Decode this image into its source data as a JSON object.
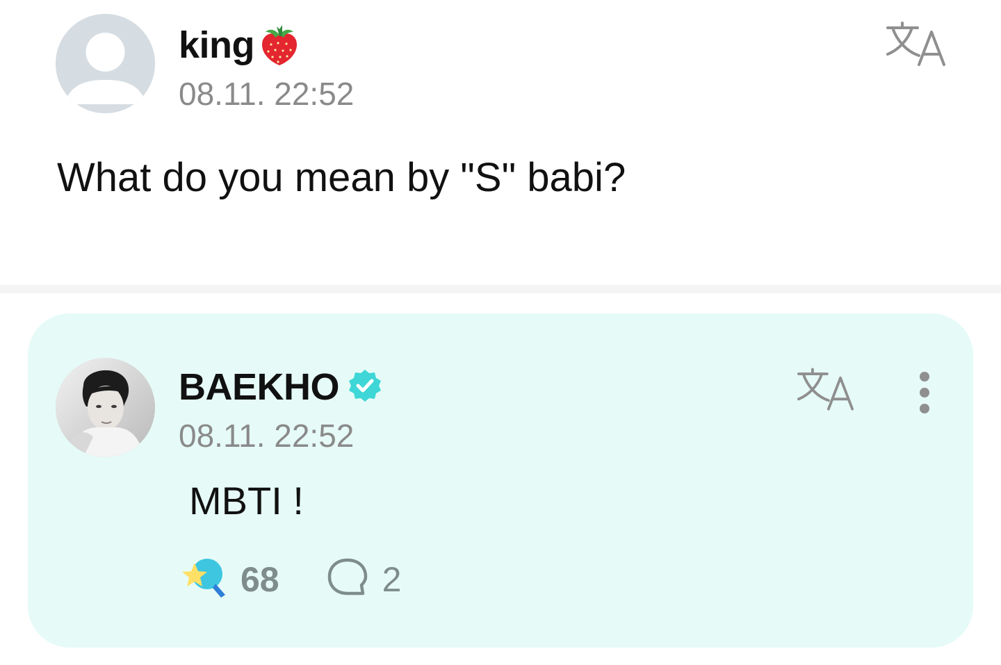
{
  "post": {
    "author": "king",
    "time": "08.11. 22:52",
    "message": "What do you mean by \"S\" babi?",
    "icons": {
      "avatar": "default-avatar-icon",
      "badge": "strawberry-icon",
      "translate": "translate-icon"
    }
  },
  "reply": {
    "author": "BAEKHO",
    "time": "08.11. 22:52",
    "message": "MBTI !",
    "likes": "68",
    "comments": "2",
    "icons": {
      "verified": "verified-badge-icon",
      "translate": "translate-icon",
      "more": "more-vertical-icon",
      "like": "star-wand-icon",
      "comment": "comment-bubble-icon"
    }
  },
  "colors": {
    "card_background": "#e6fbf7",
    "verified": "#3ed6d6",
    "muted_text": "#8a8a8a",
    "divider": "#f4f4f4"
  }
}
